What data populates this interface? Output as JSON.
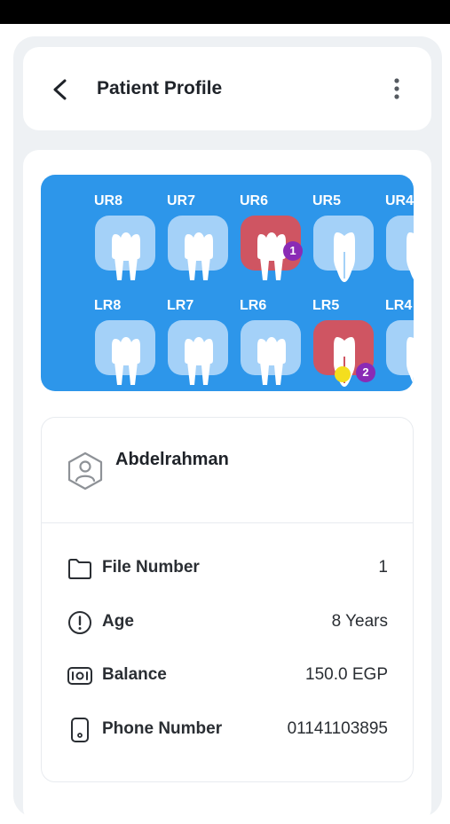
{
  "header": {
    "title": "Patient Profile",
    "back_icon": "back-arrow-icon",
    "menu_icon": "more-vertical-icon"
  },
  "dental_chart": {
    "treated_color": "#cf5562",
    "untreated_color": "#a4d1f8",
    "panel_color": "#2d96ea",
    "upper": [
      {
        "code": "UR8",
        "treated": false
      },
      {
        "code": "UR7",
        "treated": false
      },
      {
        "code": "UR6",
        "treated": true,
        "badge": "1"
      },
      {
        "code": "UR5",
        "treated": false
      },
      {
        "code": "UR4",
        "treated": false
      }
    ],
    "lower": [
      {
        "code": "LR8",
        "treated": false
      },
      {
        "code": "LR7",
        "treated": false
      },
      {
        "code": "LR6",
        "treated": false
      },
      {
        "code": "LR5",
        "treated": true,
        "badge": "2",
        "marker": true
      },
      {
        "code": "LR4",
        "treated": false
      }
    ]
  },
  "patient": {
    "name": "Abdelrahman",
    "avatar_icon": "user-hexagon-icon",
    "fields": {
      "file_number": {
        "label": "File Number",
        "value": "1",
        "icon": "folder-icon"
      },
      "age": {
        "label": "Age",
        "value": "8 Years",
        "icon": "alert-circle-icon"
      },
      "balance": {
        "label": "Balance",
        "value": "150.0 EGP",
        "icon": "money-icon"
      },
      "phone": {
        "label": "Phone Number",
        "value": "01141103895",
        "icon": "phone-icon"
      }
    }
  }
}
